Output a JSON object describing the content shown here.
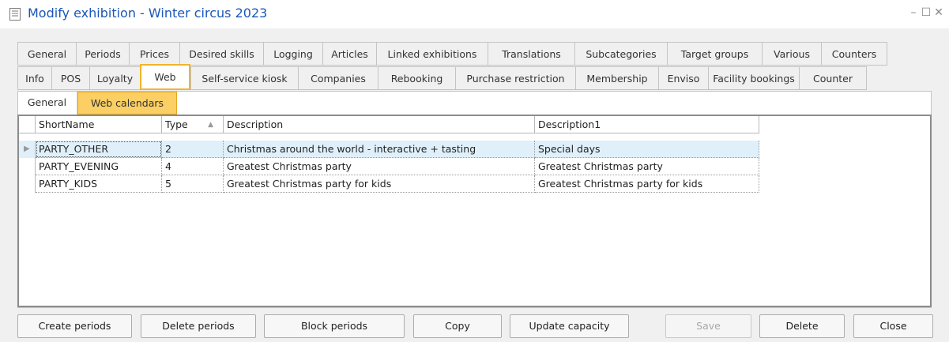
{
  "window": {
    "title": "Modify exhibition - Winter circus 2023",
    "minimize": "–",
    "maximize": "☐",
    "close": "✕"
  },
  "tabs_row1": [
    "General",
    "Periods",
    "Prices",
    "Desired skills",
    "Logging",
    "Articles",
    "Linked exhibitions",
    "Translations",
    "Subcategories",
    "Target groups",
    "Various",
    "Counters"
  ],
  "tabs_row2": [
    "Info",
    "POS",
    "Loyalty",
    "Web",
    "Self-service kiosk",
    "Companies",
    "Rebooking",
    "Purchase restriction",
    "Membership",
    "Enviso",
    "Facility bookings",
    "Counter"
  ],
  "active_tab": "Web",
  "subtabs": [
    "General",
    "Web calendars"
  ],
  "active_subtab": "Web calendars",
  "grid": {
    "columns": [
      "ShortName",
      "Type",
      "Description",
      "Description1"
    ],
    "sorted_column": "Type",
    "sort_glyph": "▲",
    "row_indicator": "▶",
    "rows": [
      {
        "short_name": "PARTY_OTHER",
        "type": "2",
        "description": "Christmas around the world - interactive + tasting",
        "description1": "Special days"
      },
      {
        "short_name": "PARTY_EVENING",
        "type": "4",
        "description": "Greatest Christmas party",
        "description1": "Greatest Christmas party"
      },
      {
        "short_name": "PARTY_KIDS",
        "type": "5",
        "description": "Greatest Christmas party for kids",
        "description1": "Greatest Christmas party for kids"
      }
    ]
  },
  "buttons": {
    "create_periods": "Create periods",
    "delete_periods": "Delete periods",
    "block_periods": "Block periods",
    "copy": "Copy",
    "update_capacity": "Update capacity",
    "save": "Save",
    "delete": "Delete",
    "close": "Close"
  },
  "colors": {
    "title": "#1a57b8",
    "active_tab_border": "#f2b32b",
    "active_subtab_bg": "#fbcf63",
    "selected_row": "#dff0fa"
  }
}
